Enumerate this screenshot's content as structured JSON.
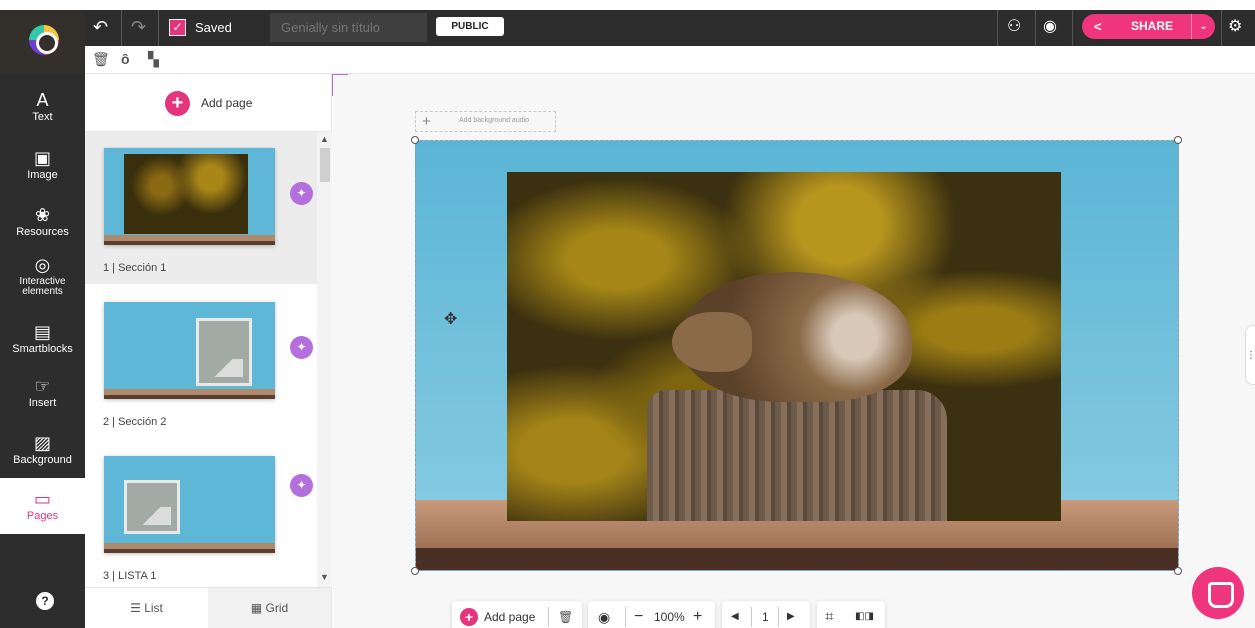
{
  "toolbar": {
    "saved_label": "Saved",
    "title_placeholder": "Genially sin título",
    "public_label": "PUBLIC",
    "share_label": "SHARE"
  },
  "sidebar": {
    "items": [
      {
        "label": "Text",
        "icon": "text-icon"
      },
      {
        "label": "Image",
        "icon": "image-icon"
      },
      {
        "label": "Resources",
        "icon": "resources-icon"
      },
      {
        "label": "Interactive elements",
        "icon": "interactive-elements-icon"
      },
      {
        "label": "Smartblocks",
        "icon": "smartblocks-icon"
      },
      {
        "label": "Insert",
        "icon": "insert-icon"
      },
      {
        "label": "Background",
        "icon": "background-icon"
      },
      {
        "label": "Pages",
        "icon": "pages-icon"
      }
    ],
    "help_label": "?"
  },
  "panel": {
    "add_page_label": "Add page",
    "pages": [
      {
        "label": "1 | Sección 1"
      },
      {
        "label": "2 | Sección 2"
      },
      {
        "label": "3 | LISTA 1"
      }
    ],
    "view_list_label": "List",
    "view_grid_label": "Grid"
  },
  "canvas": {
    "audio_label": "Add background audio"
  },
  "bottom": {
    "add_page_label": "Add page",
    "zoom": "100%",
    "page_number": "1"
  },
  "colors": {
    "accent": "#e5337c",
    "dark": "#2d2d2d"
  }
}
